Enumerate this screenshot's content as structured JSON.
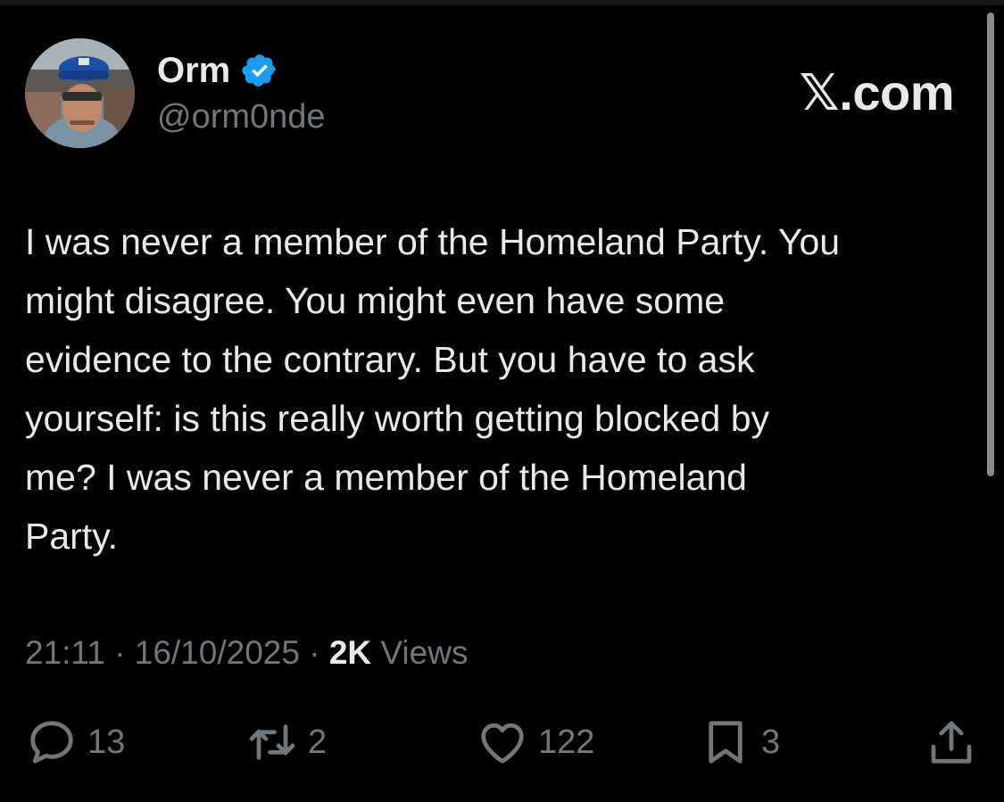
{
  "site": {
    "brand": "𝕏.com"
  },
  "author": {
    "display_name": "Orm",
    "handle": "@orm0nde",
    "verified_color": "#1d9bf0"
  },
  "tweet": {
    "text": "I was never a member of the Homeland Party. You\nmight disagree. You might even have some\nevidence to the contrary. But you have to ask\nyourself: is this really worth getting blocked by\nme? I was never a member of the Homeland\nParty.",
    "time": "21:11",
    "separator": "·",
    "date": "16/10/2025",
    "views_count": "2K",
    "views_label": "Views"
  },
  "actions": {
    "reply": {
      "icon": "reply-icon",
      "count": "13"
    },
    "repost": {
      "icon": "repost-icon",
      "count": "2"
    },
    "like": {
      "icon": "heart-icon",
      "count": "122"
    },
    "bookmark": {
      "icon": "bookmark-icon",
      "count": "3"
    },
    "share": {
      "icon": "share-icon"
    }
  },
  "colors": {
    "background": "#000000",
    "text": "#e7e9ea",
    "muted": "#71767b"
  }
}
